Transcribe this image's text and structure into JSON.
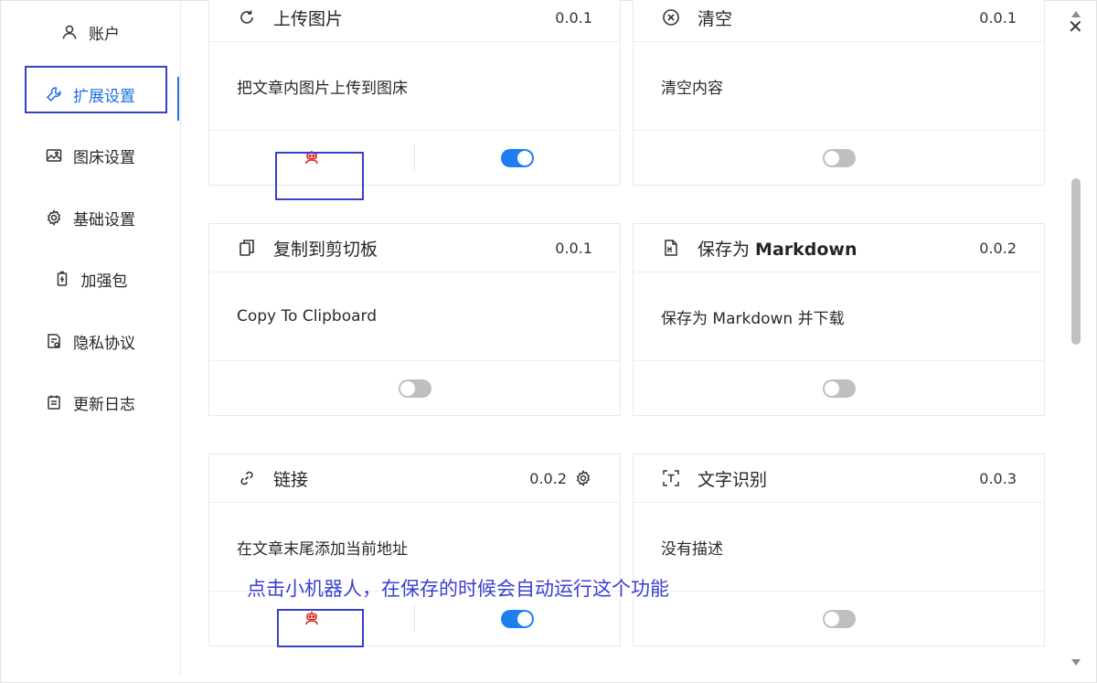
{
  "window": {
    "close_label": "✕"
  },
  "sidebar": {
    "items": [
      {
        "label": "账户",
        "icon": "user-icon"
      },
      {
        "label": "扩展设置",
        "icon": "wrench-icon",
        "active": true
      },
      {
        "label": "图床设置",
        "icon": "image-icon"
      },
      {
        "label": "基础设置",
        "icon": "gear-icon"
      },
      {
        "label": "加强包",
        "icon": "battery-icon"
      },
      {
        "label": "隐私协议",
        "icon": "privacy-doc-icon"
      },
      {
        "label": "更新日志",
        "icon": "calendar-icon"
      }
    ]
  },
  "cards": [
    {
      "title": "上传图片",
      "version": "0.0.1",
      "description": "把文章内图片上传到图床",
      "icon": "refresh-icon",
      "auto_run": true,
      "enabled": true
    },
    {
      "title": "清空",
      "version": "0.0.1",
      "description": "清空内容",
      "icon": "close-circle-icon",
      "auto_run": false,
      "enabled": false
    },
    {
      "title": "复制到剪切板",
      "version": "0.0.1",
      "description": "Copy To Clipboard",
      "icon": "copy-icon",
      "auto_run": false,
      "enabled": false
    },
    {
      "title_prefix": "保存为 ",
      "title_bold": "Markdown",
      "version": "0.0.2",
      "description": "保存为 Markdown 并下载",
      "icon": "markdown-file-icon",
      "auto_run": false,
      "enabled": false
    },
    {
      "title": "链接",
      "version": "0.0.2",
      "description": "在文章末尾添加当前地址",
      "icon": "link-icon",
      "auto_run": true,
      "enabled": true,
      "has_settings": true
    },
    {
      "title": "文字识别",
      "version": "0.0.3",
      "description": "没有描述",
      "icon": "text-recognition-icon",
      "auto_run": false,
      "enabled": false
    }
  ],
  "annotation": "点击小机器人，在保存的时候会自动运行这个功能",
  "colors": {
    "accent": "#1e6fe0",
    "toggle_on": "#1e7ef0",
    "robot": "#e0261e",
    "annotation": "#3a3fcf",
    "highlight": "#3640c8"
  }
}
